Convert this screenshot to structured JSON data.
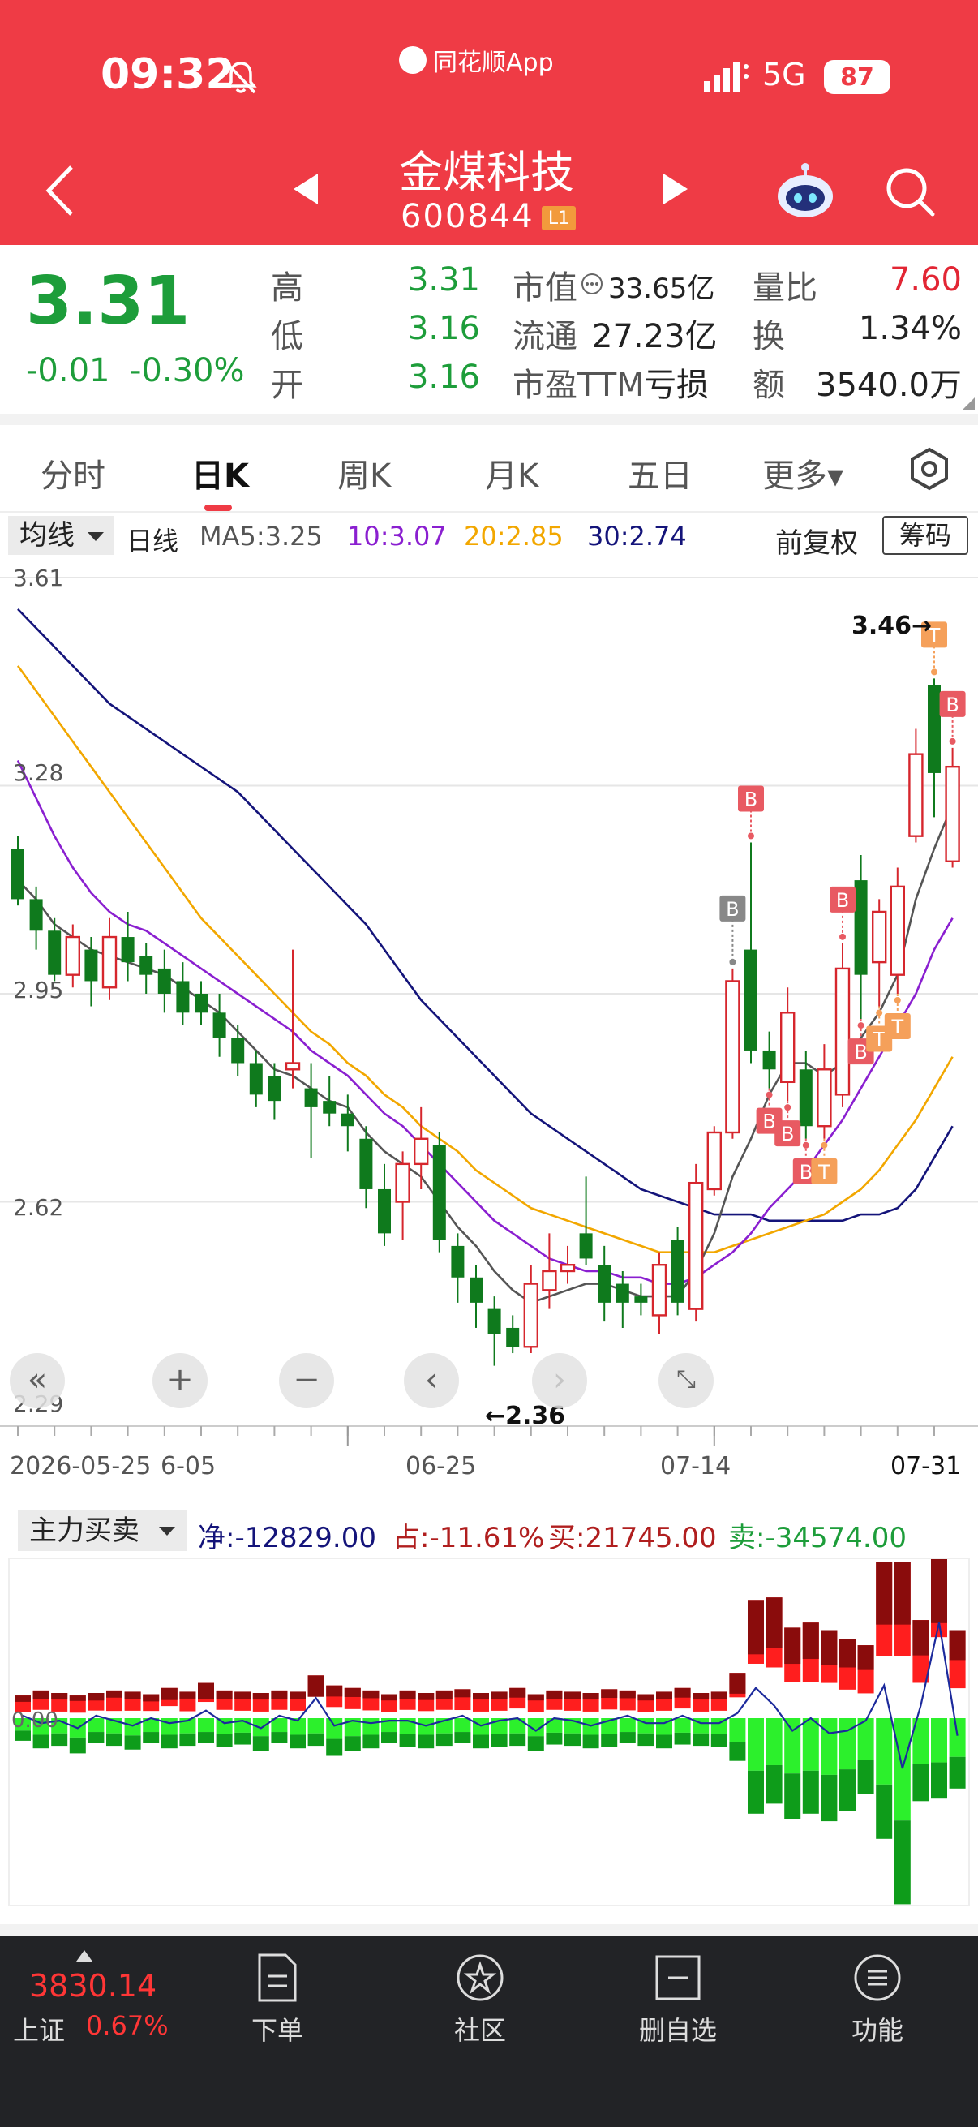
{
  "status": {
    "time": "09:32",
    "app_name": "同花顺App",
    "network": "5G",
    "battery": "87"
  },
  "nav": {
    "title": "金煤科技",
    "code": "600844",
    "level": "L1"
  },
  "quote": {
    "price": "3.31",
    "change": "-0.01",
    "change_pct": "-0.30%",
    "labels": {
      "high": "高",
      "low": "低",
      "open": "开",
      "mktcap": "市值",
      "float": "流通",
      "pe": "市盈TTM",
      "vol_ratio": "量比",
      "turnover": "换",
      "amount": "额"
    },
    "high": "3.31",
    "low": "3.16",
    "open": "3.16",
    "mktcap": "33.65亿",
    "float": "27.23亿",
    "pe": "亏损",
    "vol_ratio": "7.60",
    "turnover": "1.34%",
    "amount": "3540.0万"
  },
  "tabs": [
    {
      "label": "分时"
    },
    {
      "label": "日K"
    },
    {
      "label": "周K"
    },
    {
      "label": "月K"
    },
    {
      "label": "五日"
    },
    {
      "label": "更多▾"
    }
  ],
  "ma_bar": {
    "selector": "均线",
    "period": "日线",
    "ma5": "MA5:3.25",
    "ma10": "10:3.07",
    "ma20": "20:2.85",
    "ma30": "30:2.74",
    "adjust": "前复权",
    "chips": "筹码"
  },
  "chart_data": {
    "type": "candlestick",
    "y_ticks": [
      "3.61",
      "3.28",
      "2.95",
      "2.62",
      "2.29"
    ],
    "x_ticks": [
      "2026-05-25",
      "6-05",
      "06-25",
      "07-14",
      "07-31"
    ],
    "ylim": [
      2.29,
      3.61
    ],
    "annotations": {
      "max_label": "3.46→",
      "min_label": "←2.36"
    },
    "colors": {
      "up": "#d6262d",
      "down": "#0f7a1d",
      "ma5": "#555555",
      "ma10": "#8a1fd0",
      "ma20": "#f2a700",
      "ma30": "#14147a"
    },
    "candles": [
      [
        3.18,
        3.1,
        3.2,
        3.09
      ],
      [
        3.1,
        3.05,
        3.12,
        3.02
      ],
      [
        3.05,
        2.98,
        3.07,
        2.97
      ],
      [
        2.98,
        3.04,
        3.06,
        2.96
      ],
      [
        3.02,
        2.97,
        3.04,
        2.93
      ],
      [
        2.96,
        3.04,
        3.07,
        2.94
      ],
      [
        3.04,
        3.0,
        3.08,
        2.97
      ],
      [
        3.01,
        2.98,
        3.03,
        2.95
      ],
      [
        2.99,
        2.95,
        3.02,
        2.92
      ],
      [
        2.97,
        2.92,
        3.0,
        2.9
      ],
      [
        2.95,
        2.92,
        2.97,
        2.9
      ],
      [
        2.92,
        2.88,
        2.95,
        2.85
      ],
      [
        2.88,
        2.84,
        2.9,
        2.82
      ],
      [
        2.84,
        2.79,
        2.86,
        2.77
      ],
      [
        2.82,
        2.78,
        2.84,
        2.75
      ],
      [
        2.83,
        2.84,
        3.02,
        2.8
      ],
      [
        2.8,
        2.77,
        2.84,
        2.69
      ],
      [
        2.78,
        2.76,
        2.82,
        2.74
      ],
      [
        2.76,
        2.74,
        2.79,
        2.7
      ],
      [
        2.72,
        2.64,
        2.74,
        2.61
      ],
      [
        2.64,
        2.57,
        2.68,
        2.55
      ],
      [
        2.62,
        2.68,
        2.7,
        2.56
      ],
      [
        2.68,
        2.72,
        2.77,
        2.64
      ],
      [
        2.71,
        2.56,
        2.73,
        2.54
      ],
      [
        2.55,
        2.5,
        2.57,
        2.46
      ],
      [
        2.5,
        2.46,
        2.52,
        2.42
      ],
      [
        2.45,
        2.41,
        2.47,
        2.36
      ],
      [
        2.42,
        2.39,
        2.44,
        2.38
      ],
      [
        2.39,
        2.49,
        2.52,
        2.38
      ],
      [
        2.48,
        2.51,
        2.57,
        2.45
      ],
      [
        2.51,
        2.52,
        2.55,
        2.49
      ],
      [
        2.57,
        2.53,
        2.66,
        2.52
      ],
      [
        2.52,
        2.46,
        2.55,
        2.43
      ],
      [
        2.49,
        2.46,
        2.51,
        2.42
      ],
      [
        2.47,
        2.46,
        2.49,
        2.44
      ],
      [
        2.44,
        2.52,
        2.54,
        2.41
      ],
      [
        2.56,
        2.46,
        2.58,
        2.44
      ],
      [
        2.45,
        2.65,
        2.68,
        2.43
      ],
      [
        2.64,
        2.73,
        2.74,
        2.63
      ],
      [
        2.73,
        2.97,
        2.99,
        2.72
      ],
      [
        3.02,
        2.86,
        3.19,
        2.84
      ],
      [
        2.86,
        2.83,
        2.89,
        2.8
      ],
      [
        2.81,
        2.92,
        2.96,
        2.78
      ],
      [
        2.83,
        2.74,
        2.86,
        2.72
      ],
      [
        2.74,
        2.83,
        2.87,
        2.72
      ],
      [
        2.79,
        2.99,
        3.03,
        2.77
      ],
      [
        3.13,
        2.98,
        3.17,
        2.91
      ],
      [
        3.0,
        3.08,
        3.1,
        2.93
      ],
      [
        2.98,
        3.12,
        3.15,
        2.95
      ],
      [
        3.2,
        3.33,
        3.37,
        3.19
      ],
      [
        3.44,
        3.3,
        3.45,
        3.23
      ],
      [
        3.16,
        3.31,
        3.34,
        3.15
      ]
    ],
    "ma5": [
      3.13,
      3.1,
      3.06,
      3.04,
      3.02,
      3.01,
      3.0,
      2.99,
      2.98,
      2.96,
      2.94,
      2.92,
      2.89,
      2.86,
      2.83,
      2.82,
      2.8,
      2.78,
      2.77,
      2.73,
      2.7,
      2.68,
      2.66,
      2.62,
      2.58,
      2.55,
      2.51,
      2.48,
      2.46,
      2.47,
      2.48,
      2.49,
      2.49,
      2.48,
      2.47,
      2.47,
      2.47,
      2.51,
      2.57,
      2.66,
      2.72,
      2.79,
      2.84,
      2.84,
      2.82,
      2.84,
      2.88,
      2.92,
      2.98,
      3.1,
      3.18,
      3.25
    ],
    "ma10": [
      3.32,
      3.26,
      3.2,
      3.15,
      3.11,
      3.08,
      3.06,
      3.05,
      3.03,
      3.01,
      2.99,
      2.97,
      2.95,
      2.93,
      2.91,
      2.89,
      2.86,
      2.84,
      2.82,
      2.79,
      2.76,
      2.74,
      2.71,
      2.68,
      2.65,
      2.62,
      2.59,
      2.57,
      2.55,
      2.53,
      2.52,
      2.51,
      2.51,
      2.5,
      2.5,
      2.49,
      2.49,
      2.5,
      2.52,
      2.54,
      2.57,
      2.61,
      2.64,
      2.67,
      2.71,
      2.75,
      2.8,
      2.85,
      2.9,
      2.95,
      3.02,
      3.07
    ],
    "ma20": [
      3.47,
      3.43,
      3.39,
      3.35,
      3.31,
      3.27,
      3.23,
      3.19,
      3.15,
      3.11,
      3.07,
      3.04,
      3.01,
      2.98,
      2.95,
      2.92,
      2.89,
      2.87,
      2.84,
      2.82,
      2.79,
      2.77,
      2.74,
      2.72,
      2.7,
      2.67,
      2.65,
      2.63,
      2.61,
      2.6,
      2.59,
      2.58,
      2.57,
      2.56,
      2.55,
      2.54,
      2.54,
      2.54,
      2.54,
      2.55,
      2.56,
      2.57,
      2.58,
      2.59,
      2.6,
      2.62,
      2.64,
      2.67,
      2.71,
      2.75,
      2.8,
      2.85
    ],
    "ma30": [
      3.56,
      3.53,
      3.5,
      3.47,
      3.44,
      3.41,
      3.39,
      3.37,
      3.35,
      3.33,
      3.31,
      3.29,
      3.27,
      3.24,
      3.21,
      3.18,
      3.15,
      3.12,
      3.09,
      3.06,
      3.02,
      2.98,
      2.94,
      2.91,
      2.88,
      2.85,
      2.82,
      2.79,
      2.76,
      2.74,
      2.72,
      2.7,
      2.68,
      2.66,
      2.64,
      2.63,
      2.62,
      2.61,
      2.6,
      2.6,
      2.6,
      2.59,
      2.59,
      2.59,
      2.59,
      2.59,
      2.6,
      2.6,
      2.61,
      2.64,
      2.69,
      2.74
    ],
    "signals": [
      {
        "i": 39,
        "t": "B",
        "side": "above"
      },
      {
        "i": 40,
        "t": "B",
        "side": "above"
      },
      {
        "i": 41,
        "t": "B",
        "side": "below"
      },
      {
        "i": 42,
        "t": "B",
        "side": "below"
      },
      {
        "i": 43,
        "t": "B",
        "side": "below"
      },
      {
        "i": 44,
        "t": "T",
        "side": "below"
      },
      {
        "i": 45,
        "t": "B",
        "side": "above"
      },
      {
        "i": 46,
        "t": "B",
        "side": "below"
      },
      {
        "i": 47,
        "t": "T",
        "side": "below"
      },
      {
        "i": 48,
        "t": "T",
        "side": "below"
      },
      {
        "i": 50,
        "t": "T",
        "side": "above"
      },
      {
        "i": 51,
        "t": "B",
        "side": "above"
      }
    ],
    "flow": {
      "selector": "主力买卖",
      "net": "净:-12829.00",
      "share": "占:-11.61%",
      "buy": "买:21745.00",
      "sell": "卖:-34574.00",
      "zero_label": "0.00",
      "buy_vals": [
        18,
        22,
        20,
        18,
        20,
        22,
        21,
        19,
        24,
        21,
        28,
        22,
        21,
        20,
        22,
        21,
        34,
        26,
        24,
        22,
        19,
        22,
        20,
        22,
        23,
        20,
        21,
        24,
        19,
        22,
        21,
        20,
        23,
        22,
        19,
        21,
        24,
        20,
        21,
        36,
        94,
        96,
        72,
        76,
        70,
        63,
        58,
        124,
        124,
        78,
        140,
        70
      ],
      "sell_vals": [
        -18,
        -24,
        -22,
        -28,
        -20,
        -22,
        -25,
        -20,
        -24,
        -22,
        -20,
        -23,
        -21,
        -26,
        -20,
        -24,
        -22,
        -30,
        -26,
        -24,
        -20,
        -23,
        -24,
        -22,
        -20,
        -24,
        -23,
        -22,
        -26,
        -21,
        -22,
        -24,
        -23,
        -20,
        -22,
        -24,
        -21,
        -22,
        -23,
        -34,
        -76,
        -68,
        -80,
        -76,
        -82,
        -74,
        -60,
        -96,
        -148,
        -66,
        -64,
        -56
      ],
      "line_vals": [
        2,
        -4,
        -2,
        -8,
        2,
        -2,
        -6,
        0,
        -4,
        -2,
        6,
        -4,
        -2,
        -8,
        2,
        -2,
        16,
        -6,
        -2,
        -4,
        -2,
        -2,
        -6,
        -2,
        2,
        -6,
        -2,
        0,
        -10,
        0,
        -2,
        -6,
        -2,
        2,
        -4,
        -4,
        2,
        -4,
        -4,
        4,
        24,
        10,
        -10,
        0,
        -12,
        -10,
        -2,
        26,
        -40,
        10,
        76,
        -14
      ],
      "dark_ratio": [
        0.28,
        0.3,
        0.26,
        0.24,
        0.3,
        0.26,
        0.28,
        0.3,
        0.4,
        0.26,
        0.46,
        0.3,
        0.28,
        0.26,
        0.3,
        0.28,
        0.5,
        0.34,
        0.3,
        0.28,
        0.26,
        0.3,
        0.28,
        0.3,
        0.28,
        0.26,
        0.28,
        0.32,
        0.26,
        0.3,
        0.28,
        0.26,
        0.3,
        0.28,
        0.26,
        0.28,
        0.32,
        0.26,
        0.28,
        0.46,
        0.46,
        0.42,
        0.4,
        0.38,
        0.4,
        0.36,
        0.34,
        0.4,
        0.4,
        0.36,
        0.46,
        0.34
      ]
    }
  },
  "bottom_nav": {
    "index_value": "3830.14",
    "index_name": "上证",
    "index_pct": "0.67%",
    "items": [
      {
        "label": "下单"
      },
      {
        "label": "社区"
      },
      {
        "label": "删自选"
      },
      {
        "label": "功能"
      }
    ]
  }
}
